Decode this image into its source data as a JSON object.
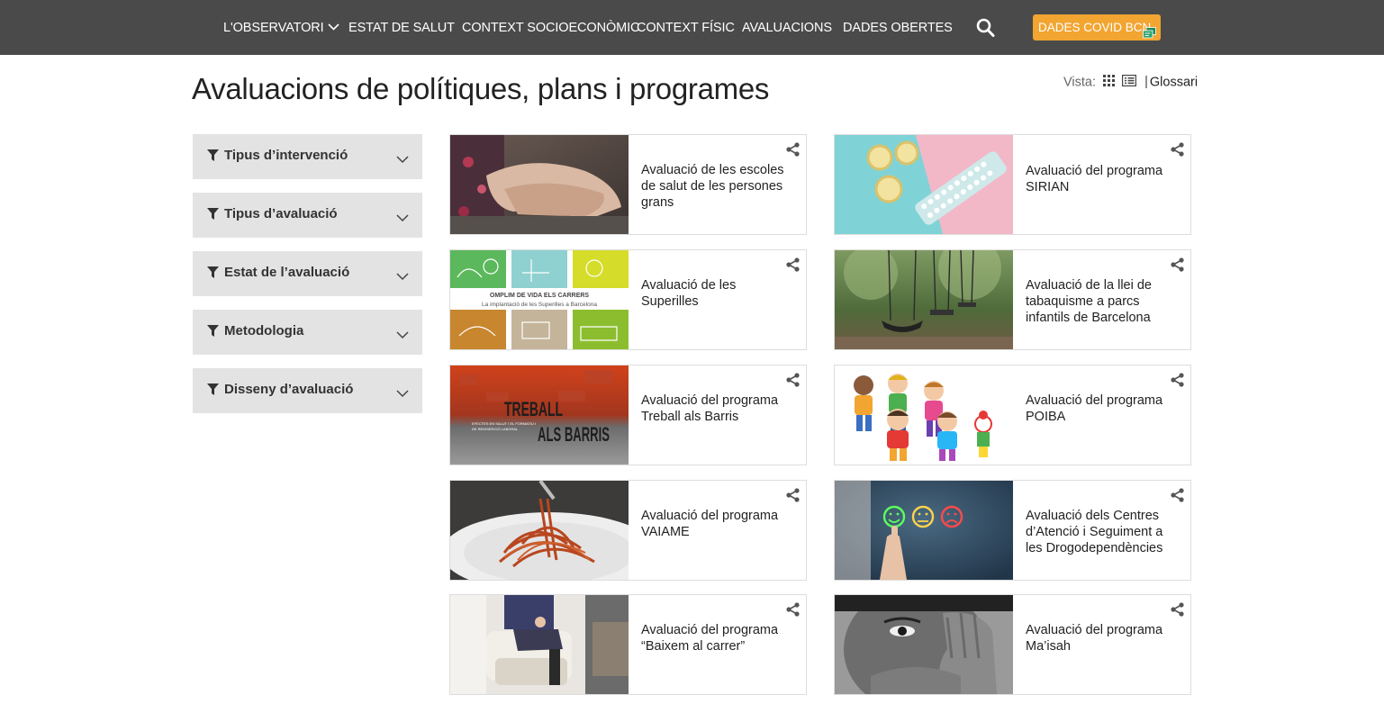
{
  "nav": {
    "items": [
      {
        "label": "L'OBSERVATORI",
        "has_dropdown": true
      },
      {
        "label": "ESTAT DE SALUT"
      },
      {
        "label": "CONTEXT SOCIOECONÒMIC"
      },
      {
        "label": "CONTEXT FÍSIC"
      },
      {
        "label": "AVALUACIONS"
      },
      {
        "label": "DADES OBERTES"
      }
    ],
    "search_icon": "search-icon",
    "covid_button": "DADES COVID BCN",
    "covid_icon": "dashboard-icon"
  },
  "colors": {
    "topbar": "#4a4a4a",
    "accent": "#f2a531",
    "filter_bg": "#e3e3e3",
    "card_border": "#dddddd"
  },
  "page": {
    "title": "Avaluacions de polítiques, plans i programes",
    "view_label": "Vista:",
    "view_icons": [
      "grid-icon",
      "list-icon"
    ],
    "separator": "|",
    "glossary": "Glossari"
  },
  "filters": [
    {
      "label": "Tipus d’intervenció"
    },
    {
      "label": "Tipus d’avaluació"
    },
    {
      "label": "Estat de l’avaluació"
    },
    {
      "label": "Metodologia"
    },
    {
      "label": "Disseny d’avaluació"
    }
  ],
  "cards": [
    {
      "title": "Avaluació de les escoles de salut de les persones grans",
      "image": "elderly-hands-photo"
    },
    {
      "title": "Avaluació del programa SIRIAN",
      "image": "contraceptives-photo"
    },
    {
      "title": "Avaluació de les Superilles",
      "image": "superilles-poster",
      "image_text": {
        "line1": "OMPLIM DE VIDA ELS CARRERS",
        "line2": "La implantació de les Superilles a Barcelona"
      }
    },
    {
      "title": "Avaluació de la llei de tabaquisme a parcs infantils de Barcelona",
      "image": "playground-swings-photo"
    },
    {
      "title": "Avaluació del programa Treball als Barris",
      "image": "treball-barris-poster",
      "image_text": {
        "line1": "TREBALL",
        "line2": "ALS BARRIS",
        "small1": "EFECTES EN SALUT I EL FORMATIU I",
        "small2": "DE REINSERCIÓ LABORAL"
      }
    },
    {
      "title": "Avaluació del programa POIBA",
      "image": "children-illustration"
    },
    {
      "title": "Avaluació del programa VAIAME",
      "image": "spaghetti-photo"
    },
    {
      "title": "Avaluació dels Centres d’Atenció i Seguiment a les Drogodependències",
      "image": "satisfaction-faces-photo"
    },
    {
      "title": "Avaluació del programa “Baixem al carrer”",
      "image": "stairlift-photo"
    },
    {
      "title": "Avaluació del programa Ma’isah",
      "image": "face-hand-photo"
    }
  ],
  "share_icon": "share-icon",
  "filter_icon": "filter-icon",
  "chevron_icon": "chevron-down-icon"
}
